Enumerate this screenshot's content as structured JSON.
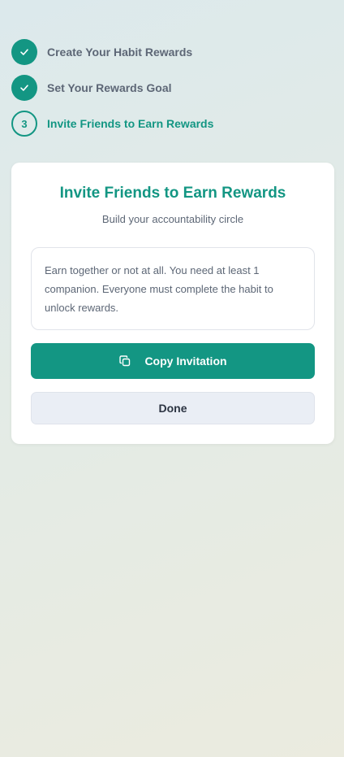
{
  "steps": [
    {
      "label": "Create Your Habit Rewards",
      "status": "done",
      "icon": "check-icon"
    },
    {
      "label": "Set Your Rewards Goal",
      "status": "done",
      "icon": "check-icon"
    },
    {
      "label": "Invite Friends to Earn Rewards",
      "status": "current",
      "number": "3"
    }
  ],
  "card": {
    "title": "Invite Friends to Earn Rewards",
    "subtitle": "Build your accountability circle",
    "info": "Earn together or not at all. You need at least 1 companion. Everyone must complete the habit to unlock rewards.",
    "copy_button_label": "Copy Invitation",
    "copy_button_icon": "copy-icon",
    "done_button_label": "Done"
  },
  "colors": {
    "accent": "#139683",
    "muted_text": "#5d6776",
    "secondary_button_bg": "#eaeef5"
  }
}
